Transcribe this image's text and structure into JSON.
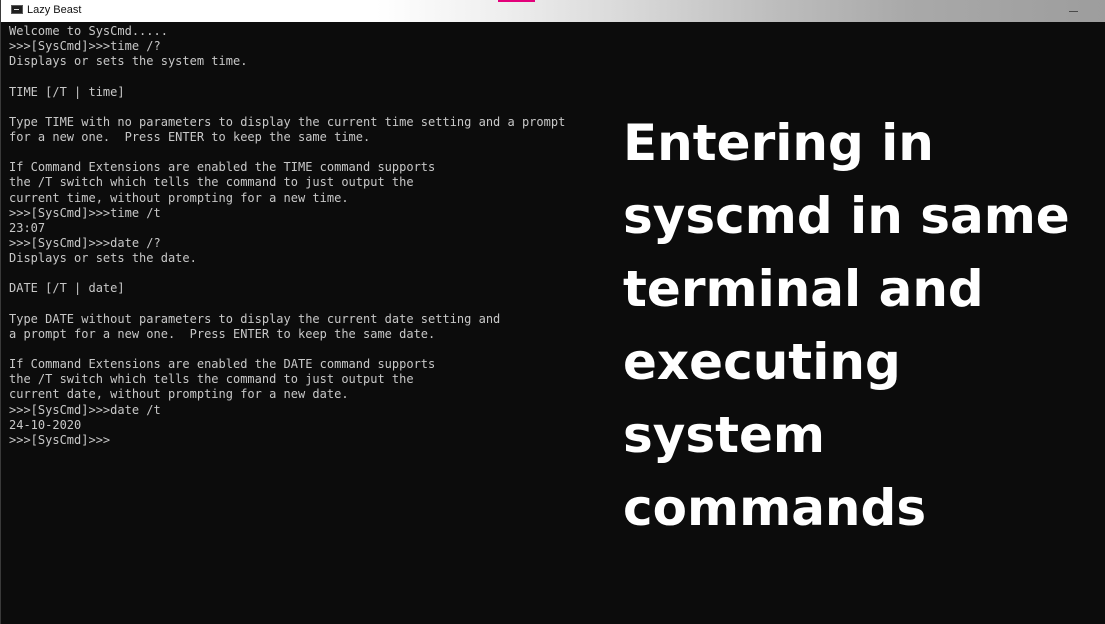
{
  "window": {
    "title": "Lazy Beast"
  },
  "terminal": {
    "lines": [
      "Welcome to SysCmd.....",
      ">>>[SysCmd]>>>time /?",
      "Displays or sets the system time.",
      "",
      "TIME [/T | time]",
      "",
      "Type TIME with no parameters to display the current time setting and a prompt",
      "for a new one.  Press ENTER to keep the same time.",
      "",
      "If Command Extensions are enabled the TIME command supports",
      "the /T switch which tells the command to just output the",
      "current time, without prompting for a new time.",
      ">>>[SysCmd]>>>time /t",
      "23:07",
      ">>>[SysCmd]>>>date /?",
      "Displays or sets the date.",
      "",
      "DATE [/T | date]",
      "",
      "Type DATE without parameters to display the current date setting and",
      "a prompt for a new one.  Press ENTER to keep the same date.",
      "",
      "If Command Extensions are enabled the DATE command supports",
      "the /T switch which tells the command to just output the",
      "current date, without prompting for a new date.",
      ">>>[SysCmd]>>>date /t",
      "24-10-2020",
      ">>>[SysCmd]>>>"
    ]
  },
  "overlay": {
    "lines": [
      "Entering in",
      "syscmd in same",
      "terminal and",
      "executing",
      "system",
      "commands"
    ]
  }
}
